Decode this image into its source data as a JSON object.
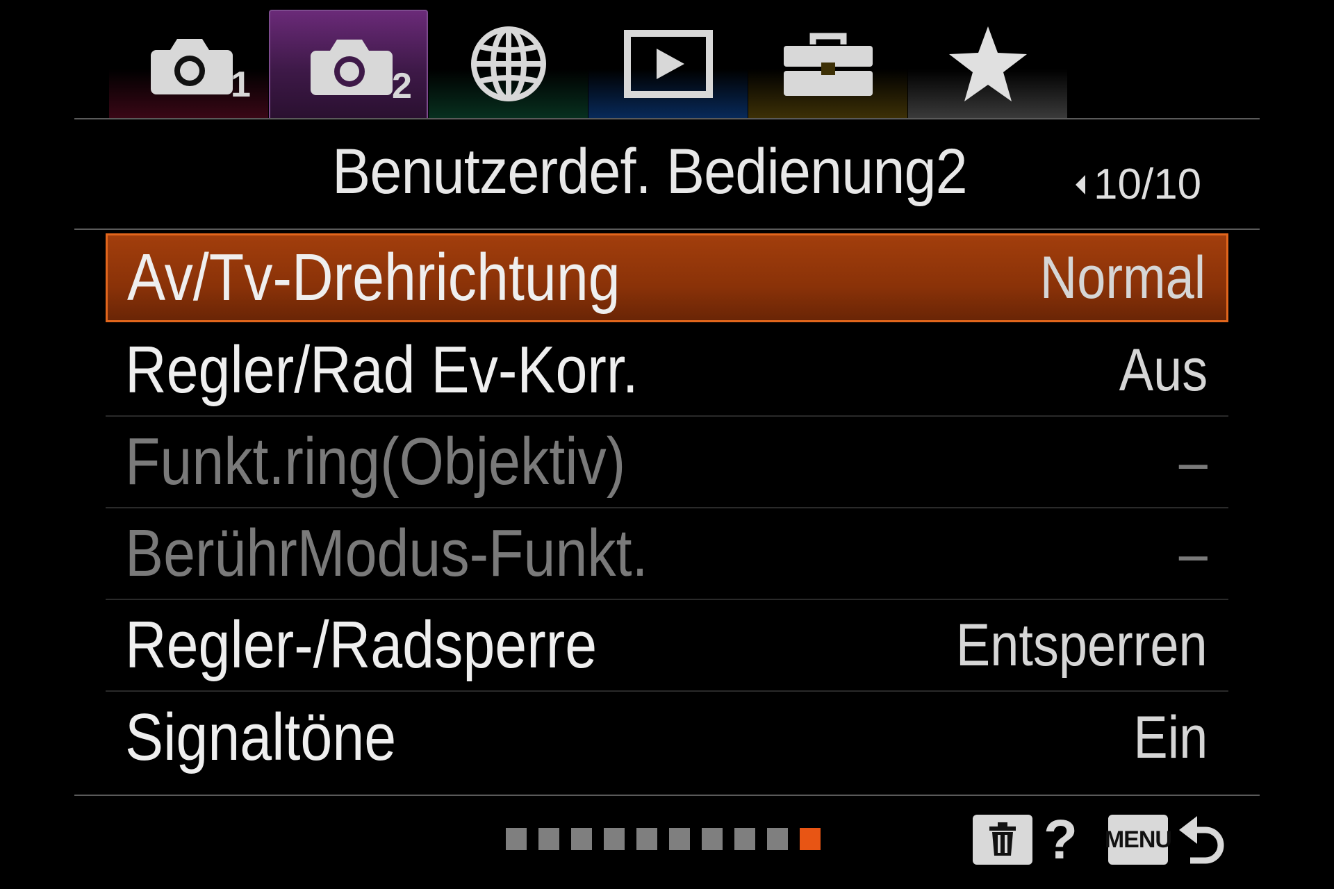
{
  "tabs": [
    {
      "id": "camera1",
      "icon": "camera-icon",
      "number": "1"
    },
    {
      "id": "camera2",
      "icon": "camera-icon",
      "number": "2",
      "selected": true
    },
    {
      "id": "network",
      "icon": "globe-icon"
    },
    {
      "id": "playback",
      "icon": "play-icon"
    },
    {
      "id": "setup",
      "icon": "toolbox-icon"
    },
    {
      "id": "mymenu",
      "icon": "star-icon"
    }
  ],
  "header": {
    "title": "Benutzerdef. Bedienung2",
    "page": "10/10"
  },
  "menu": {
    "items": [
      {
        "label": "Av/Tv-Drehrichtung",
        "value": "Normal",
        "state": "selected"
      },
      {
        "label": "Regler/Rad Ev-Korr.",
        "value": "Aus",
        "state": "enabled"
      },
      {
        "label": "Funkt.ring(Objektiv)",
        "value": "–",
        "state": "disabled"
      },
      {
        "label": "BerührModus-Funkt.",
        "value": "–",
        "state": "disabled"
      },
      {
        "label": "Regler-/Radsperre",
        "value": "Entsperren",
        "state": "enabled"
      },
      {
        "label": "Signaltöne",
        "value": "Ein",
        "state": "enabled"
      }
    ]
  },
  "footer": {
    "page_count": 10,
    "current_page": 10,
    "help_symbol": "?",
    "menu_key": "MENU",
    "icons": [
      "trash-icon",
      "help-icon",
      "menu-key",
      "back-icon"
    ]
  },
  "colors": {
    "selection": "#a23e0c",
    "selection_border": "#e2661c",
    "active_page_dot": "#e85514",
    "disabled_text": "#7a7a7a",
    "tab_camera1": "#3a0716",
    "tab_camera2": "#6a2a78",
    "tab_network": "#07301f",
    "tab_playback": "#082a5a",
    "tab_setup": "#3d3006",
    "tab_mymenu": "#3a3a3a"
  }
}
